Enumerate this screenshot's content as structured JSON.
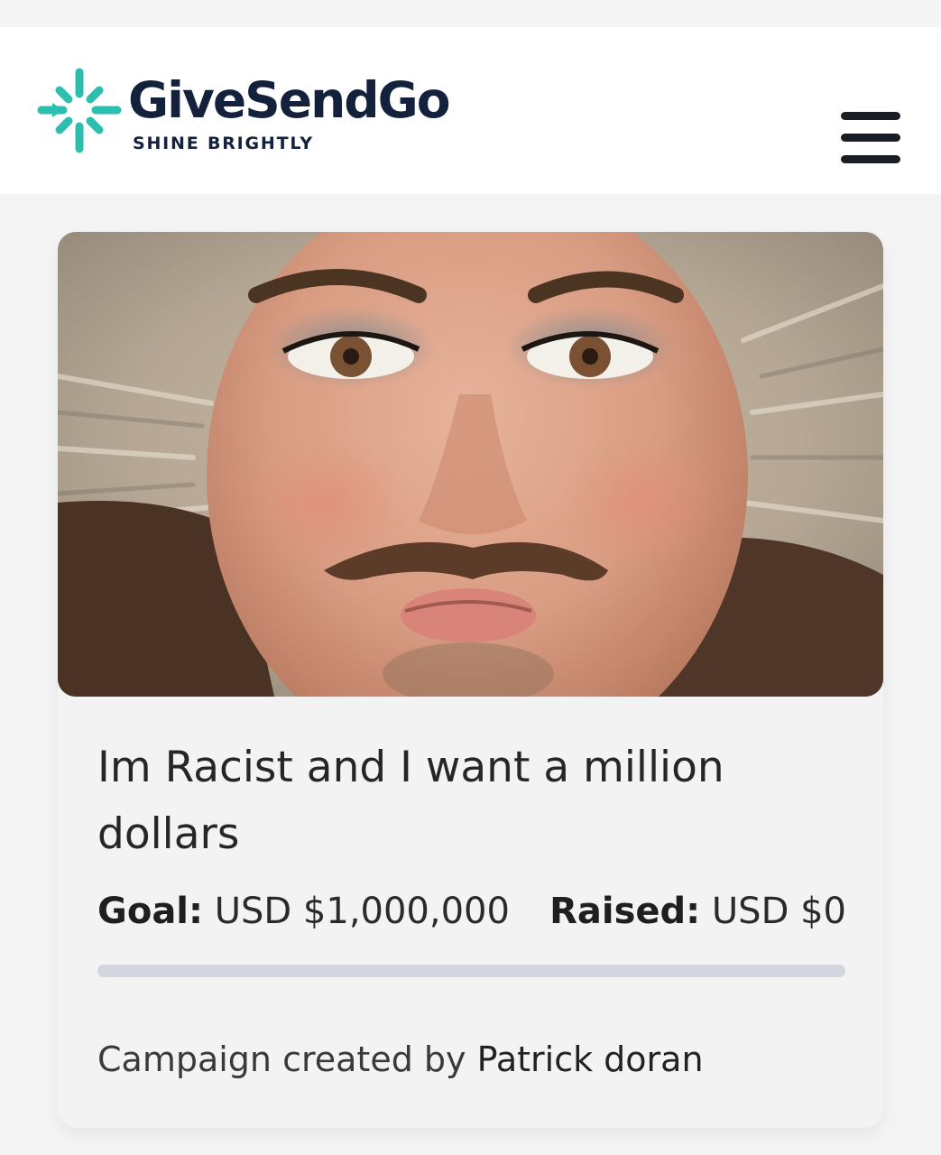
{
  "header": {
    "brand_name": "GiveSendGo",
    "tagline": "SHINE BRIGHTLY",
    "menu_icon": "hamburger-menu-icon",
    "brand_color": "#2cbfb0",
    "text_color": "#14213d"
  },
  "campaign": {
    "image_description": "Campaign cover photo",
    "title": "Im Racist and I want a million dollars",
    "goal_label": "Goal:",
    "goal_value": "USD $1,000,000",
    "raised_label": "Raised:",
    "raised_value": "USD $0",
    "progress_percent": 0,
    "creator_prefix": "Campaign created by",
    "creator_name": "Patrick doran"
  }
}
